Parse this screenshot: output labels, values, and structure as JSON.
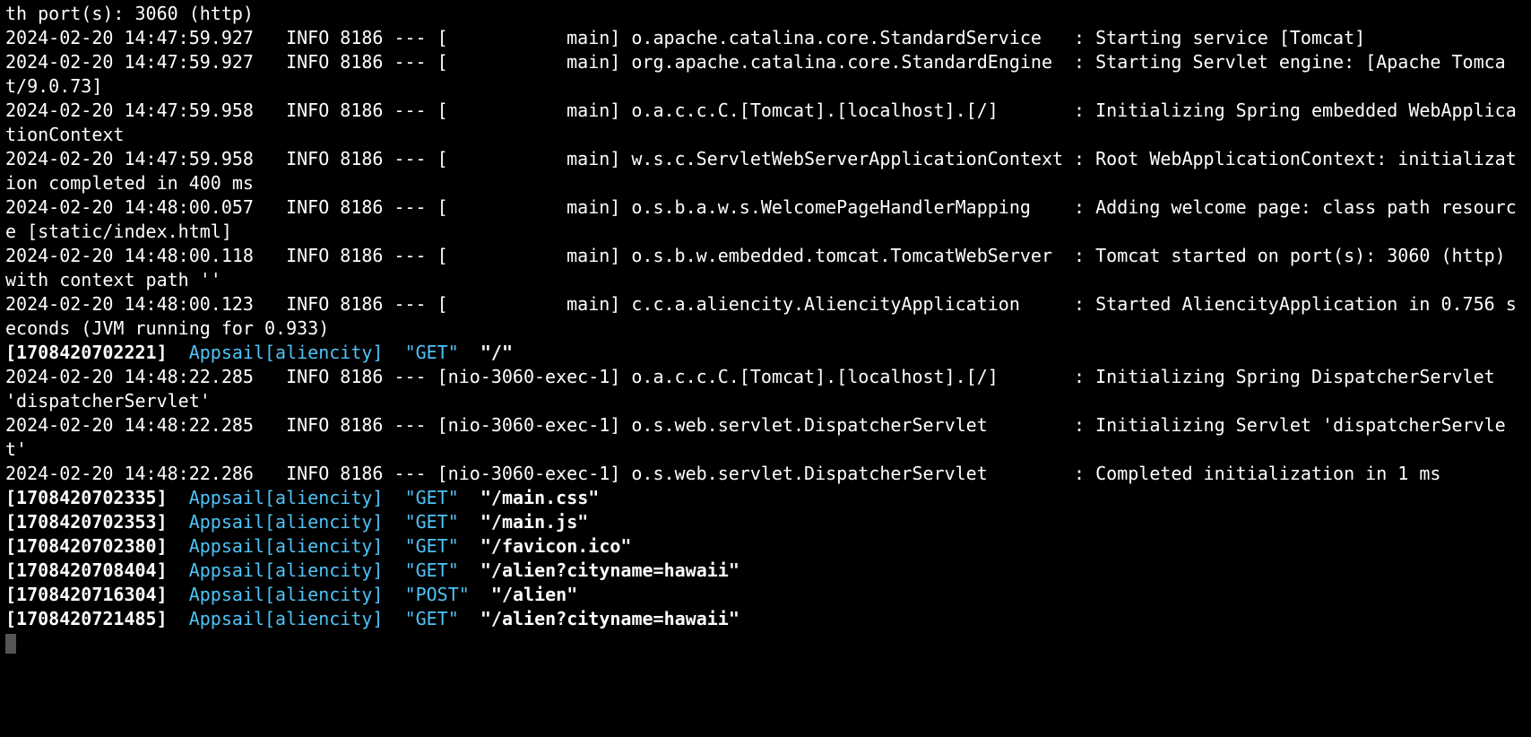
{
  "log_first": "th port(s): 3060 (http)",
  "spring": [
    {
      "ts": "2024-02-20 14:47:59.927",
      "lvl": "INFO",
      "pid": "8186",
      "sep": "---",
      "thread": "main",
      "logger": "o.apache.catalina.core.StandardService",
      "msg": "Starting service [Tomcat]"
    },
    {
      "ts": "2024-02-20 14:47:59.927",
      "lvl": "INFO",
      "pid": "8186",
      "sep": "---",
      "thread": "main",
      "logger": "org.apache.catalina.core.StandardEngine",
      "msg": "Starting Servlet engine: [Apache Tomcat/9.0.73]"
    },
    {
      "ts": "2024-02-20 14:47:59.958",
      "lvl": "INFO",
      "pid": "8186",
      "sep": "---",
      "thread": "main",
      "logger": "o.a.c.c.C.[Tomcat].[localhost].[/]",
      "msg": "Initializing Spring embedded WebApplicationContext"
    },
    {
      "ts": "2024-02-20 14:47:59.958",
      "lvl": "INFO",
      "pid": "8186",
      "sep": "---",
      "thread": "main",
      "logger": "w.s.c.ServletWebServerApplicationContext",
      "msg": "Root WebApplicationContext: initialization completed in 400 ms"
    },
    {
      "ts": "2024-02-20 14:48:00.057",
      "lvl": "INFO",
      "pid": "8186",
      "sep": "---",
      "thread": "main",
      "logger": "o.s.b.a.w.s.WelcomePageHandlerMapping",
      "msg": "Adding welcome page: class path resource [static/index.html]"
    },
    {
      "ts": "2024-02-20 14:48:00.118",
      "lvl": "INFO",
      "pid": "8186",
      "sep": "---",
      "thread": "main",
      "logger": "o.s.b.w.embedded.tomcat.TomcatWebServer",
      "msg": "Tomcat started on port(s): 3060 (http) with context path ''"
    },
    {
      "ts": "2024-02-20 14:48:00.123",
      "lvl": "INFO",
      "pid": "8186",
      "sep": "---",
      "thread": "main",
      "logger": "c.c.a.aliencity.AliencityApplication",
      "msg": "Started AliencityApplication in 0.756 seconds (JVM running for 0.933)"
    }
  ],
  "access1": {
    "epoch": "1708420702221",
    "service": "Appsail[aliencity]",
    "method": "GET",
    "path": "/"
  },
  "spring2": [
    {
      "ts": "2024-02-20 14:48:22.285",
      "lvl": "INFO",
      "pid": "8186",
      "sep": "---",
      "thread": "nio-3060-exec-1",
      "logger": "o.a.c.c.C.[Tomcat].[localhost].[/]",
      "msg": "Initializing Spring DispatcherServlet 'dispatcherServlet'"
    },
    {
      "ts": "2024-02-20 14:48:22.285",
      "lvl": "INFO",
      "pid": "8186",
      "sep": "---",
      "thread": "nio-3060-exec-1",
      "logger": "o.s.web.servlet.DispatcherServlet",
      "msg": "Initializing Servlet 'dispatcherServlet'"
    },
    {
      "ts": "2024-02-20 14:48:22.286",
      "lvl": "INFO",
      "pid": "8186",
      "sep": "---",
      "thread": "nio-3060-exec-1",
      "logger": "o.s.web.servlet.DispatcherServlet",
      "msg": "Completed initialization in 1 ms"
    }
  ],
  "access2": [
    {
      "epoch": "1708420702335",
      "service": "Appsail[aliencity]",
      "method": "GET",
      "path": "/main.css"
    },
    {
      "epoch": "1708420702353",
      "service": "Appsail[aliencity]",
      "method": "GET",
      "path": "/main.js"
    },
    {
      "epoch": "1708420702380",
      "service": "Appsail[aliencity]",
      "method": "GET",
      "path": "/favicon.ico"
    },
    {
      "epoch": "1708420708404",
      "service": "Appsail[aliencity]",
      "method": "GET",
      "path": "/alien?cityname=hawaii"
    },
    {
      "epoch": "1708420716304",
      "service": "Appsail[aliencity]",
      "method": "POST",
      "path": "/alien"
    },
    {
      "epoch": "1708420721485",
      "service": "Appsail[aliencity]",
      "method": "GET",
      "path": "/alien?cityname=hawaii"
    }
  ],
  "col_widths": {
    "ts": 25,
    "lvl": 5,
    "pid": 4,
    "sep": 3,
    "thread": 15,
    "logger": 40
  }
}
